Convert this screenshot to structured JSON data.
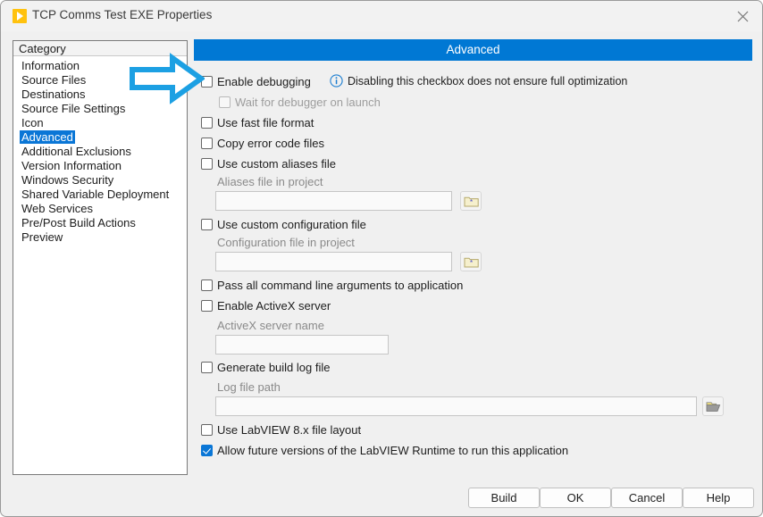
{
  "window": {
    "title": "TCP Comms Test EXE Properties",
    "app_icon": "labview-play-icon",
    "close_icon": "close-icon"
  },
  "colors": {
    "accent_blue": "#0078D4",
    "selection_blue": "#0A76D6",
    "annotation_arrow": "#1CA0E3",
    "window_bg": "#F0F0F0",
    "titlebar_bg": "#F2F2F2"
  },
  "category_list": {
    "header": "Category",
    "selected": "Advanced",
    "items": [
      "Information",
      "Source Files",
      "Destinations",
      "Source File Settings",
      "Icon",
      "Advanced",
      "Additional Exclusions",
      "Version Information",
      "Windows Security",
      "Shared Variable Deployment",
      "Web Services",
      "Pre/Post Build Actions",
      "Preview"
    ]
  },
  "panel": {
    "header": "Advanced",
    "info_note": "Disabling this checkbox does not ensure full optimization",
    "info_icon": "info-circle-icon",
    "checkboxes": {
      "enable_debugging": {
        "label": "Enable debugging",
        "checked": false,
        "disabled": false
      },
      "wait_for_debugger": {
        "label": "Wait for debugger on launch",
        "checked": false,
        "disabled": true
      },
      "use_fast_file_format": {
        "label": "Use fast file format",
        "checked": false,
        "disabled": false
      },
      "copy_error_code_files": {
        "label": "Copy error code files",
        "checked": false,
        "disabled": false
      },
      "use_custom_aliases_file": {
        "label": "Use custom aliases file",
        "checked": false,
        "disabled": false
      },
      "use_custom_configuration_file": {
        "label": "Use custom configuration file",
        "checked": false,
        "disabled": false
      },
      "pass_all_command_line_arguments": {
        "label": "Pass all command line arguments to application",
        "checked": false,
        "disabled": false
      },
      "enable_activex_server": {
        "label": "Enable ActiveX server",
        "checked": false,
        "disabled": false
      },
      "generate_build_log_file": {
        "label": "Generate build log file",
        "checked": false,
        "disabled": false
      },
      "use_labview_8x_file_layout": {
        "label": "Use LabVIEW 8.x file layout",
        "checked": false,
        "disabled": false
      },
      "allow_future_runtime": {
        "label": "Allow future versions of the LabVIEW Runtime to run this application",
        "checked": true,
        "disabled": false
      }
    },
    "fields": {
      "aliases_file": {
        "label": "Aliases file in project",
        "value": "",
        "browse_icon": "folder-asterisk-icon"
      },
      "configuration_file": {
        "label": "Configuration file in project",
        "value": "",
        "browse_icon": "folder-asterisk-icon"
      },
      "activex_server_name": {
        "label": "ActiveX server name",
        "value": ""
      },
      "log_file_path": {
        "label": "Log file path",
        "value": "",
        "browse_icon": "open-folder-icon"
      }
    }
  },
  "buttons": {
    "build": "Build",
    "ok": "OK",
    "cancel": "Cancel",
    "help": "Help"
  },
  "annotation": {
    "arrow": "right-arrow-annotation",
    "points_at": "Enable debugging"
  }
}
